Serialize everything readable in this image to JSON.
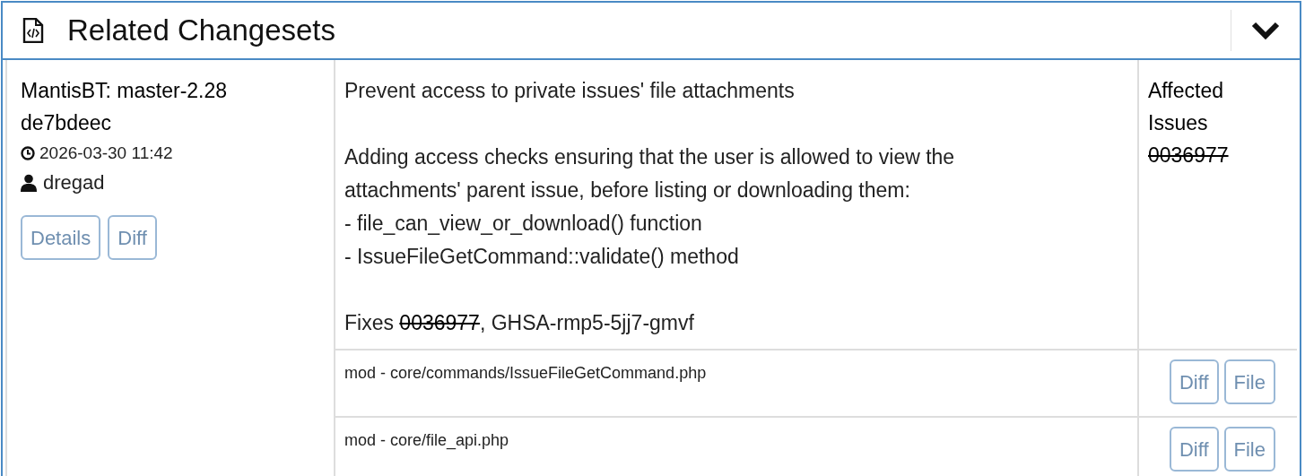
{
  "panel": {
    "title": "Related Changesets",
    "expanded": true
  },
  "changesets": [
    {
      "repository": "MantisBT: master-2.28",
      "revision": "de7bdeec",
      "timestamp": "2026-03-30 11:42",
      "author": "dregad",
      "buttons": [
        "Details",
        "Diff"
      ],
      "message": {
        "summary": "Prevent access to private issues' file attachments",
        "body": [
          "Adding access checks ensuring that the user is allowed to view the attachments' parent issue, before listing or downloading them:",
          "- file_can_view_or_download() function",
          "- IssueFileGetCommand::validate() method"
        ],
        "fixes": {
          "prefix": "Fixes ",
          "issue": {
            "number": "0036977",
            "resolved": true
          },
          "suffix": ", GHSA-rmp5-5jj7-gmvf"
        }
      },
      "affected_label": "Affected Issues",
      "affected_issues": [
        {
          "number": "0036977",
          "resolved": true
        }
      ],
      "files": [
        {
          "line": "mod - core/commands/IssueFileGetCommand.php",
          "buttons": [
            "Diff",
            "File"
          ]
        },
        {
          "line": "mod - core/file_api.php",
          "buttons": [
            "Diff",
            "File"
          ]
        }
      ]
    }
  ]
}
